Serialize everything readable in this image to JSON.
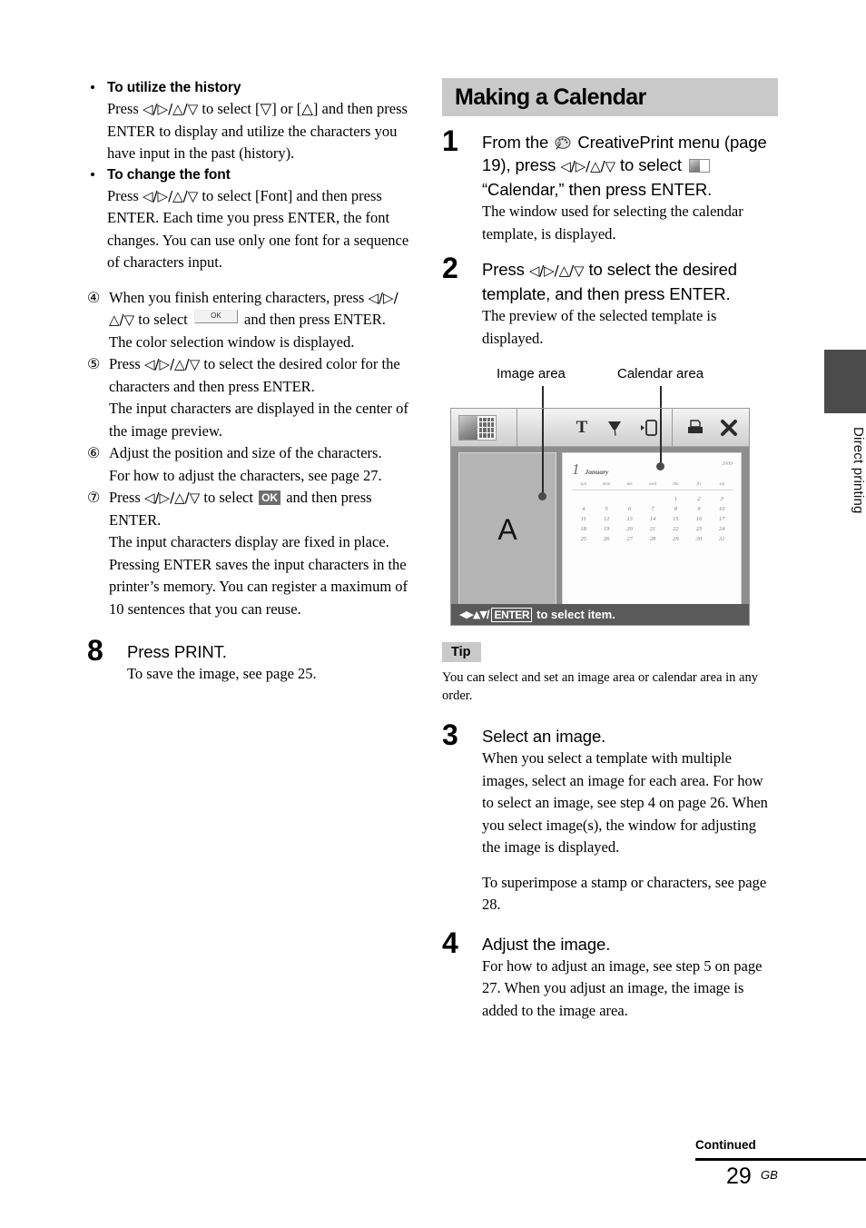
{
  "left_column": {
    "bullets": [
      {
        "heading": "To utilize the history",
        "body_pre": "Press ",
        "arrows": "◁/▷/△/▽",
        "body_post": " to select [▽] or [△] and then press ENTER to display and utilize the characters you have input in the past (history)."
      },
      {
        "heading": "To change the font",
        "body_pre": "Press ",
        "arrows": "◁/▷/△/▽",
        "body_post": " to select [Font] and then press ENTER. Each time you press ENTER, the font changes. You can use only one font for a sequence of characters input."
      }
    ],
    "circled_steps": [
      {
        "num": "④",
        "part1": "When you finish entering characters, press ",
        "arrows": "◁/▷/△/▽",
        "part2": " to select ",
        "inline_button": "OK",
        "part3": " and then press ENTER.",
        "extra": "The color selection window is displayed."
      },
      {
        "num": "⑤",
        "part1": "Press ",
        "arrows": "◁/▷/△/▽",
        "part2": " to select the desired color for the characters and then press ENTER.",
        "extra": "The input characters are displayed in the center of the image preview."
      },
      {
        "num": "⑥",
        "part1": "Adjust the position and size of the characters.",
        "extra": "For how to adjust the characters, see page 27."
      },
      {
        "num": "⑦",
        "part1": "Press ",
        "arrows": "◁/▷/△/▽",
        "part2": " to select ",
        "inline_badge": "OK",
        "part3": " and then press ENTER.",
        "extra": "The input characters display are fixed in place.",
        "extra2": "Pressing ENTER saves the input characters in the printer’s memory. You can register a maximum of 10 sentences that you can reuse."
      }
    ],
    "step8": {
      "num": "8",
      "title": "Press PRINT.",
      "desc": "To save the image, see page 25."
    }
  },
  "right_column": {
    "section_title": "Making a Calendar",
    "step1": {
      "num": "1",
      "title_a": "From the",
      "palette_icon": "palette-icon",
      "title_b": "CreativePrint menu (page 19), press",
      "arrows": "◁/▷/△/▽",
      "title_c": "to select",
      "calendar_icon": "calendar-template-icon",
      "title_d": "“Calendar,” then press ENTER.",
      "desc": "The window used for selecting the calendar template, is displayed."
    },
    "step2": {
      "num": "2",
      "title_a": "Press",
      "arrows": "◁/▷/△/▽",
      "title_b": "to select the desired template, and then press ENTER.",
      "desc": "The preview of the selected template is displayed."
    },
    "figure": {
      "callout_image_area": "Image area",
      "callout_calendar_area": "Calendar area",
      "toolbar_icons": [
        "calendar-image-thumbnail-icon",
        "text-T-icon",
        "stamp-icon",
        "frame-icon",
        "print-icon",
        "close-x-icon"
      ],
      "image_area_letter": "A",
      "calendar": {
        "month_number": "1",
        "month_name": "January",
        "year": "2009",
        "weekdays": [
          "sun",
          "mon",
          "tue",
          "wed",
          "thu",
          "fri",
          "sat"
        ],
        "weeks": [
          [
            "",
            "",
            "",
            "",
            "1",
            "2",
            "3"
          ],
          [
            "4",
            "5",
            "6",
            "7",
            "8",
            "9",
            "10"
          ],
          [
            "11",
            "12",
            "13",
            "14",
            "15",
            "16",
            "17"
          ],
          [
            "18",
            "19",
            "20",
            "21",
            "22",
            "23",
            "24"
          ],
          [
            "25",
            "26",
            "27",
            "28",
            "29",
            "30",
            "31"
          ]
        ]
      },
      "status_arrows": "◀▶▲▼",
      "status_slash": "/",
      "status_enter": "ENTER",
      "status_text": "to select item."
    },
    "tip": {
      "label": "Tip",
      "body": "You can select and set an image area or calendar area in any order."
    },
    "step3": {
      "num": "3",
      "title": "Select an image.",
      "desc": "When you select a template with multiple images, select an image for each area. For how to select an image, see step 4 on page 26. When you select image(s), the window for adjusting the image is displayed.",
      "desc2": "To superimpose a stamp or characters, see page 28."
    },
    "step4": {
      "num": "4",
      "title": "Adjust the image.",
      "desc": "For how to adjust an image, see step 5 on page 27. When you adjust an image, the image is added to the image area."
    }
  },
  "side_tab": {
    "label": "Direct printing"
  },
  "footer": {
    "continued": "Continued",
    "page_number": "29",
    "region": "GB"
  }
}
